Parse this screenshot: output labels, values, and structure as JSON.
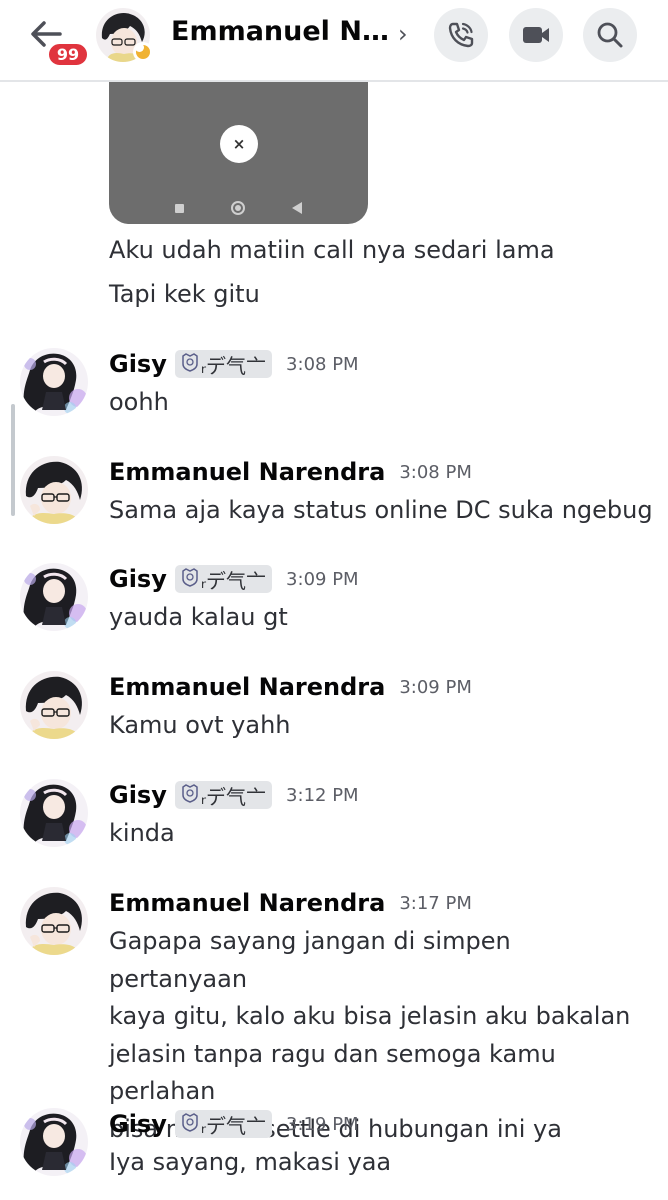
{
  "header": {
    "unread_count": "99",
    "title": "Emmanuel Na...",
    "chevron": "›",
    "icons": {
      "back": "arrow-left-icon",
      "call": "phone-icon",
      "video": "video-camera-icon",
      "search": "search-icon"
    },
    "status": "idle"
  },
  "image_embed": {
    "close_glyph": "×"
  },
  "previous_lines": [
    "Aku udah matiin call nya sedari lama",
    "Tapi kek gitu"
  ],
  "tag_text": "ᵣデ气亠",
  "messages": [
    {
      "author": "Gisy",
      "has_tag": true,
      "time": "3:08 PM",
      "lines": [
        "oohh"
      ]
    },
    {
      "author": "Emmanuel Narendra",
      "has_tag": false,
      "time": "3:08 PM",
      "lines": [
        "Sama aja kaya status online DC suka ngebug"
      ]
    },
    {
      "author": "Gisy",
      "has_tag": true,
      "time": "3:09 PM",
      "lines": [
        "yauda kalau gt"
      ]
    },
    {
      "author": "Emmanuel Narendra",
      "has_tag": false,
      "time": "3:09 PM",
      "lines": [
        "Kamu ovt yahh"
      ]
    },
    {
      "author": "Gisy",
      "has_tag": true,
      "time": "3:12 PM",
      "lines": [
        "kinda"
      ]
    },
    {
      "author": "Emmanuel Narendra",
      "has_tag": false,
      "time": "3:17 PM",
      "lines": [
        "Gapapa sayang jangan di simpen pertanyaan",
        "kaya gitu, kalo aku bisa jelasin aku bakalan",
        "jelasin tanpa ragu dan semoga kamu perlahan",
        "bisa merasa settle di hubungan ini ya"
      ]
    },
    {
      "author": "Gisy",
      "has_tag": true,
      "time": "3:19 PM",
      "lines": [
        "Iya sayang, makasi yaa"
      ]
    }
  ],
  "colors": {
    "accent_badge": "#e0343e",
    "idle_status": "#f0b232",
    "tag_bg": "#e3e5e8"
  }
}
